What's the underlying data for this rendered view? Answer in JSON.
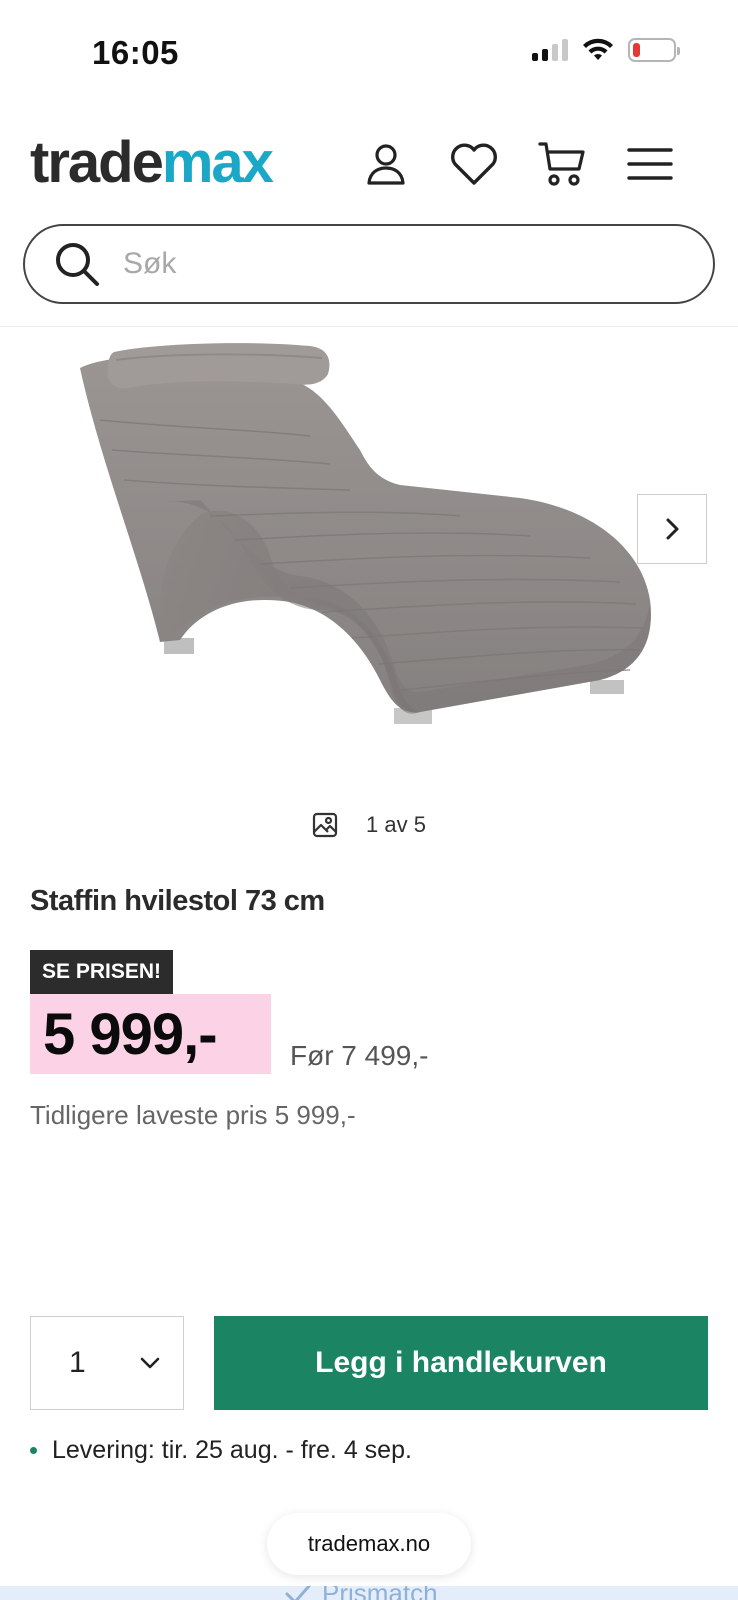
{
  "status_bar": {
    "time": "16:05",
    "signal_icon": "cellular-signal-icon",
    "wifi_icon": "wifi-icon",
    "battery_icon": "battery-low-icon",
    "battery_color": "#e53935"
  },
  "header": {
    "logo_part1": "trade",
    "logo_part2": "max",
    "logo_colors": {
      "trade": "#2b2b2b",
      "max": "#1ba8c7"
    },
    "icons": [
      "user-icon",
      "heart-icon",
      "cart-icon",
      "menu-icon"
    ]
  },
  "search": {
    "placeholder": "Søk",
    "value": "",
    "icon": "search-icon"
  },
  "gallery": {
    "counter": "1 av 5",
    "counter_icon": "image-icon",
    "next_icon": "chevron-right-icon",
    "image_alt": "grey chaise lounge"
  },
  "product": {
    "title": "Staffin hvilestol 73 cm",
    "badge": "SE PRISEN!",
    "price": "5 999,-",
    "price_before": "Før 7 499,-",
    "lowest_price": "Tidligere laveste pris 5 999,-",
    "price_highlight_color": "#fcd3e6"
  },
  "purchase": {
    "quantity": "1",
    "add_to_cart_label": "Legg i handlekurven",
    "button_color": "#1b8462"
  },
  "delivery": {
    "text": "Levering: tir. 25 aug. - fre. 4 sep."
  },
  "browser": {
    "url": "trademax.no"
  },
  "bottom_banner": {
    "label": "Prismatch"
  }
}
